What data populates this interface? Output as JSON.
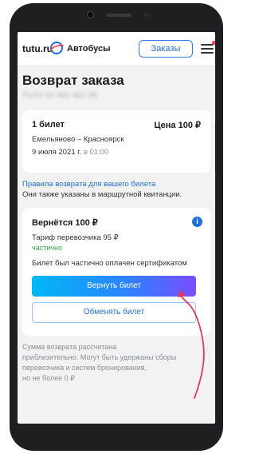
{
  "header": {
    "logo_text": "tutu.ru",
    "logo_sub": "Автобусы",
    "orders_label": "Заказы"
  },
  "page": {
    "title": "Возврат заказа",
    "order_number": "TUTU 01-461 461 58"
  },
  "ticket": {
    "count": "1 билет",
    "price": "Цена 100 ₽",
    "route": "Емельяново – Красноярск",
    "date": "9 июля 2021 г.",
    "time": "в 01:00"
  },
  "rules": {
    "link": "Правила возврата для вашего билета",
    "note": "Они также указаны в маршрутной квитанции."
  },
  "refund": {
    "amount": "Вернётся 100 ₽",
    "tariff": "Тариф перевозчика 95 ₽",
    "partial": "частично",
    "certificate": "Билет был частично оплачен сертификатом",
    "return_button": "Вернуть билет",
    "exchange_button": "Обменять билет"
  },
  "disclaimer": {
    "line1": "Сумма возврата рассчитана",
    "line2": "приблизительно. Могут быть удержаны сборы",
    "line3": "перевозчика и систем бронирования,",
    "line4": "но не более 0 ₽"
  },
  "colors": {
    "accent": "#1f6fd9",
    "success": "#2ea44f",
    "annotation_arrow": "#e8345a"
  }
}
